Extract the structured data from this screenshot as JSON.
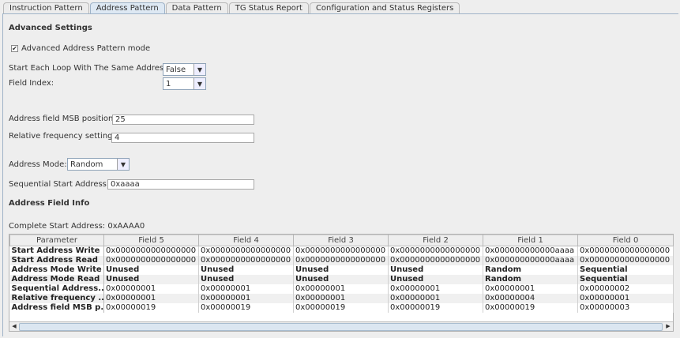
{
  "tabs": [
    {
      "label": "Instruction Pattern"
    },
    {
      "label": "Address Pattern"
    },
    {
      "label": "Data Pattern"
    },
    {
      "label": "TG Status Report"
    },
    {
      "label": "Configuration and Status Registers"
    }
  ],
  "active_tab": "Address Pattern",
  "advanced": {
    "heading": "Advanced Settings",
    "mode_checkbox": "Advanced Address Pattern mode",
    "mode_checked": true,
    "same_address_label": "Start Each Loop With The Same Address:",
    "same_address_value": "False",
    "field_index_label": "Field Index:",
    "field_index_value": "1",
    "msb_label": "Address field MSB position:",
    "msb_value": "25",
    "freq_label": "Relative frequency setting:",
    "freq_value": "4",
    "mode_label": "Address Mode:",
    "mode_value": "Random",
    "seq_label": "Sequential Start Address:",
    "seq_value": "0xaaaa"
  },
  "info": {
    "heading": "Address Field Info",
    "complete": "Complete Start Address: 0xAAAA0"
  },
  "table": {
    "headers": [
      "Parameter",
      "Field 5",
      "Field 4",
      "Field 3",
      "Field 2",
      "Field 1",
      "Field 0"
    ],
    "rows": [
      [
        "Start Address Write",
        "0x0000000000000000",
        "0x0000000000000000",
        "0x0000000000000000",
        "0x0000000000000000",
        "0x000000000000aaaa",
        "0x0000000000000000"
      ],
      [
        "Start Address Read",
        "0x0000000000000000",
        "0x0000000000000000",
        "0x0000000000000000",
        "0x0000000000000000",
        "0x000000000000aaaa",
        "0x0000000000000000"
      ],
      [
        "Address Mode Write",
        "Unused",
        "Unused",
        "Unused",
        "Unused",
        "Random",
        "Sequential"
      ],
      [
        "Address Mode Read",
        "Unused",
        "Unused",
        "Unused",
        "Unused",
        "Random",
        "Sequential"
      ],
      [
        "Sequential Address...",
        "0x00000001",
        "0x00000001",
        "0x00000001",
        "0x00000001",
        "0x00000001",
        "0x00000002"
      ],
      [
        "Relative frequency ...",
        "0x00000001",
        "0x00000001",
        "0x00000001",
        "0x00000001",
        "0x00000004",
        "0x00000001"
      ],
      [
        "Address field MSB p...",
        "0x00000019",
        "0x00000019",
        "0x00000019",
        "0x00000019",
        "0x00000019",
        "0x00000003"
      ]
    ]
  }
}
